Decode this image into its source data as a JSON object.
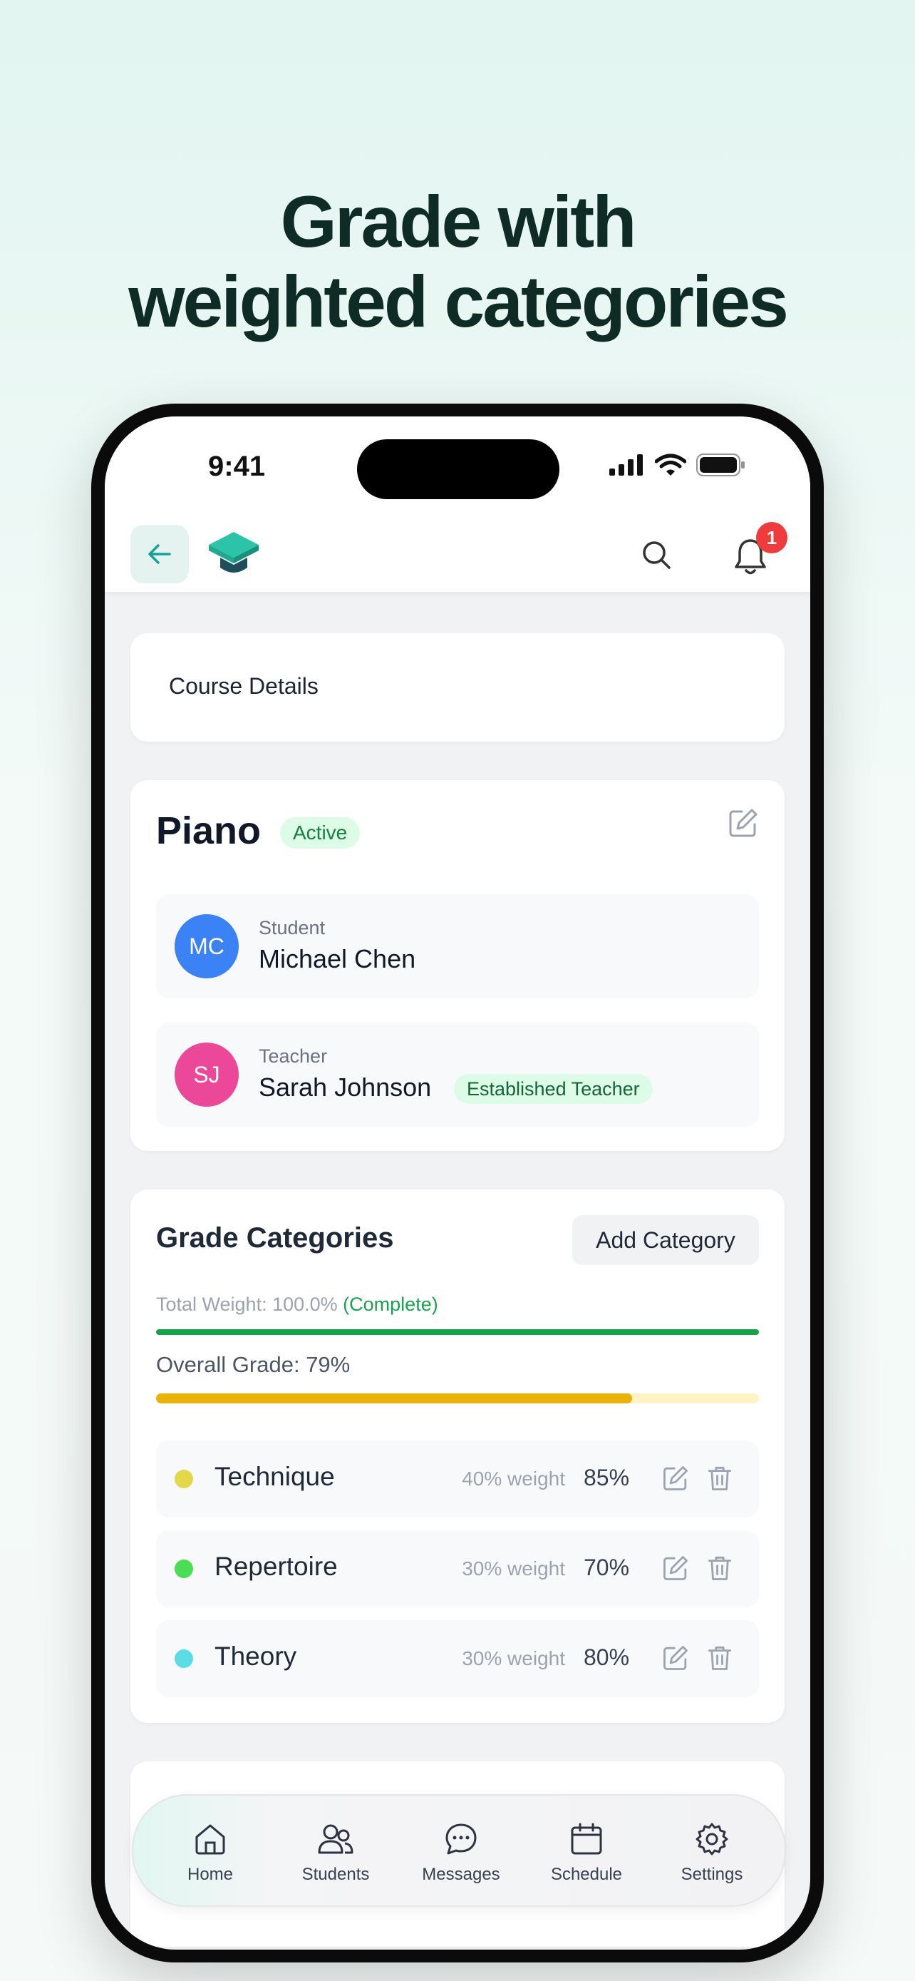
{
  "headline": {
    "line1": "Grade with",
    "line2": "weighted categories"
  },
  "status_bar": {
    "time": "9:41"
  },
  "header": {
    "notification_count": "1"
  },
  "course_details": {
    "title": "Course Details"
  },
  "course": {
    "name": "Piano",
    "status": "Active",
    "student": {
      "role": "Student",
      "initials": "MC",
      "name": "Michael Chen",
      "color": "#3b82f6"
    },
    "teacher": {
      "role": "Teacher",
      "initials": "SJ",
      "name": "Sarah Johnson",
      "badge": "Established Teacher",
      "color": "#ec4899"
    }
  },
  "grades": {
    "title": "Grade Categories",
    "add_label": "Add Category",
    "total_weight_label": "Total Weight: 100.0%",
    "total_weight_status": "(Complete)",
    "total_weight_fraction": 1.0,
    "overall_label": "Overall Grade: 79%",
    "overall_fraction": 0.79,
    "categories": [
      {
        "name": "Technique",
        "weight": "40% weight",
        "score": "85%",
        "color": "#e3d84a"
      },
      {
        "name": "Repertoire",
        "weight": "30% weight",
        "score": "70%",
        "color": "#4ade57"
      },
      {
        "name": "Theory",
        "weight": "30% weight",
        "score": "80%",
        "color": "#5cdde6"
      }
    ]
  },
  "tabs": [
    {
      "label": "Home",
      "icon": "home-icon"
    },
    {
      "label": "Students",
      "icon": "users-icon"
    },
    {
      "label": "Messages",
      "icon": "chat-icon"
    },
    {
      "label": "Schedule",
      "icon": "calendar-icon"
    },
    {
      "label": "Settings",
      "icon": "gear-icon"
    }
  ],
  "colors": {
    "accent": "#14b8a6",
    "headline": "#0e2b25",
    "success": "#16a34a",
    "warning": "#eab308"
  }
}
